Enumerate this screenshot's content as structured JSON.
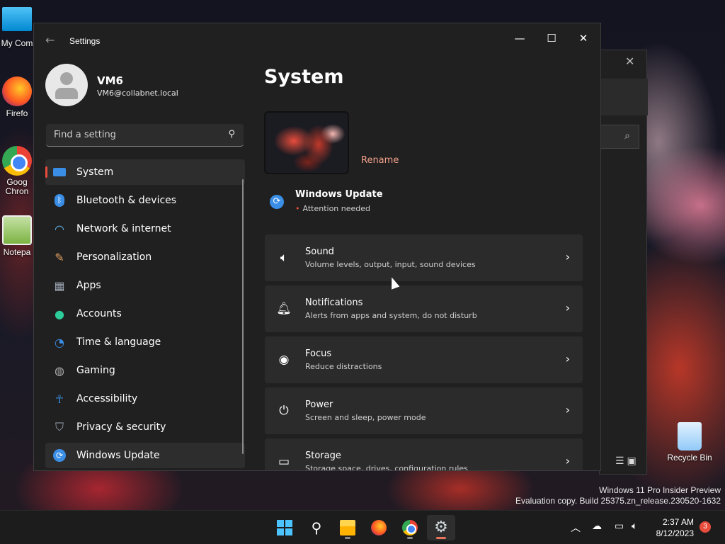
{
  "desktop": {
    "icons": [
      {
        "label": "My Com",
        "icon": "computer-icon"
      },
      {
        "label": "Firefo",
        "icon": "firefox-icon"
      },
      {
        "label": "Goog\nChron",
        "icon": "chrome-icon"
      },
      {
        "label": "Notepa",
        "icon": "notepad-icon"
      },
      {
        "label": "Recycle Bin",
        "icon": "recycle-bin-icon"
      }
    ],
    "watermark": {
      "line1": "Windows 11 Pro Insider Preview",
      "line2": "Evaluation copy. Build 25375.zn_release.230520-1632"
    }
  },
  "window": {
    "title": "Settings",
    "controls": {
      "minimize": "—",
      "maximize": "☐",
      "close": "✕"
    }
  },
  "profile": {
    "name": "VM6",
    "email": "VM6@collabnet.local"
  },
  "search": {
    "placeholder": "Find a setting",
    "value": ""
  },
  "sidebar": {
    "items": [
      {
        "label": "System",
        "icon": "system-icon",
        "color": "#3a8ee6"
      },
      {
        "label": "Bluetooth & devices",
        "icon": "bluetooth-icon",
        "color": "#3a8ee6"
      },
      {
        "label": "Network & internet",
        "icon": "wifi-icon",
        "color": "#60b8f0"
      },
      {
        "label": "Personalization",
        "icon": "brush-icon",
        "color": "#e0a060"
      },
      {
        "label": "Apps",
        "icon": "apps-icon",
        "color": "#9aa4b0"
      },
      {
        "label": "Accounts",
        "icon": "accounts-icon",
        "color": "#2ecc9a"
      },
      {
        "label": "Time & language",
        "icon": "globe-clock-icon",
        "color": "#3a8ee6"
      },
      {
        "label": "Gaming",
        "icon": "gamepad-icon",
        "color": "#b0b0b0"
      },
      {
        "label": "Accessibility",
        "icon": "accessibility-icon",
        "color": "#3a8ee6"
      },
      {
        "label": "Privacy & security",
        "icon": "shield-icon",
        "color": "#9aa4b0"
      },
      {
        "label": "Windows Update",
        "icon": "windows-update-icon",
        "color": "#3a8ee6"
      }
    ]
  },
  "main": {
    "title": "System",
    "rename_label": "Rename",
    "windows_update": {
      "title": "Windows Update",
      "status": "Attention needed"
    },
    "cards": [
      {
        "title": "Sound",
        "subtitle": "Volume levels, output, input, sound devices",
        "icon": "speaker-icon"
      },
      {
        "title": "Notifications",
        "subtitle": "Alerts from apps and system, do not disturb",
        "icon": "bell-icon"
      },
      {
        "title": "Focus",
        "subtitle": "Reduce distractions",
        "icon": "focus-icon"
      },
      {
        "title": "Power",
        "subtitle": "Screen and sleep, power mode",
        "icon": "power-icon"
      },
      {
        "title": "Storage",
        "subtitle": "Storage space, drives, configuration rules",
        "icon": "storage-icon"
      }
    ]
  },
  "taskbar": {
    "apps": [
      "start-icon",
      "search-icon",
      "file-explorer-icon",
      "firefox-icon",
      "chrome-icon",
      "settings-icon"
    ],
    "time": "2:37 AM",
    "date": "8/12/2023",
    "notification_count": "3"
  },
  "colors": {
    "accent": "#e8735c",
    "rename_link": "#f2a08a",
    "attention_dot": "#e74c3c",
    "window_bg": "#202020",
    "card_bg": "#2b2b2b"
  }
}
